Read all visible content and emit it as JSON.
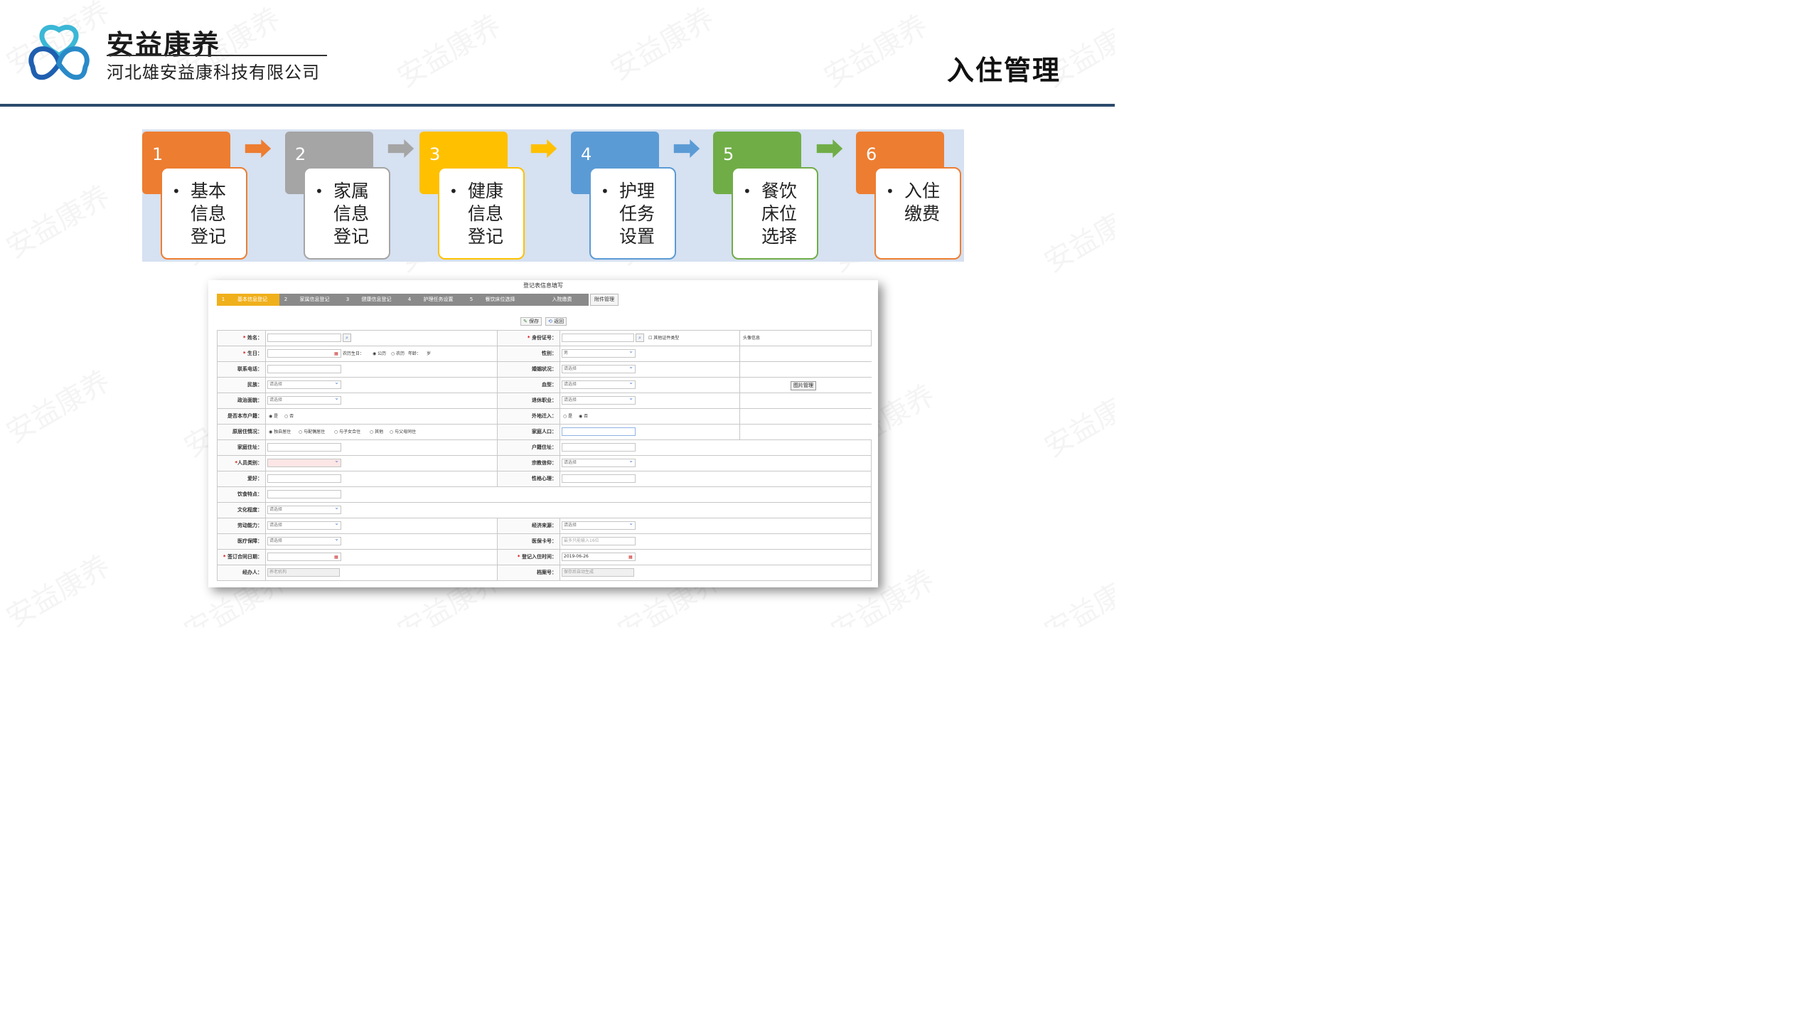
{
  "header": {
    "brand_name": "安益康养",
    "company": "河北雄安益康科技有限公司",
    "page_title": "入住管理",
    "logo_icon": "tri-loop-logo-icon",
    "watermark": "安益康养"
  },
  "process": {
    "steps": [
      {
        "num": "1",
        "lines": [
          "基本",
          "信息",
          "登记"
        ],
        "color": "#ed7d31"
      },
      {
        "num": "2",
        "lines": [
          "家属",
          "信息",
          "登记"
        ],
        "color": "#a5a5a5"
      },
      {
        "num": "3",
        "lines": [
          "健康",
          "信息",
          "登记"
        ],
        "color": "#ffc000"
      },
      {
        "num": "4",
        "lines": [
          "护理",
          "任务",
          "设置"
        ],
        "color": "#5b9bd5"
      },
      {
        "num": "5",
        "lines": [
          "餐饮",
          "床位",
          "选择"
        ],
        "color": "#70ad47"
      },
      {
        "num": "6",
        "lines": [
          "入住",
          "缴费"
        ],
        "color": "#ed7d31"
      }
    ],
    "arrow_colors": [
      "#ed7d31",
      "#a5a5a5",
      "#ffc000",
      "#5b9bd5",
      "#70ad47"
    ],
    "bullet": "•"
  },
  "form_screen": {
    "title": "登记表信息填写",
    "tabs": [
      {
        "num": "1",
        "label": "基本信息登记",
        "active": true
      },
      {
        "num": "2",
        "label": "家属信息登记"
      },
      {
        "num": "3",
        "label": "健康信息登记"
      },
      {
        "num": "4",
        "label": "护理任务设置"
      },
      {
        "num": "5",
        "label": "餐饮床位选择"
      },
      {
        "num": "",
        "label": "入院缴费"
      }
    ],
    "attach_tab": "附件管理",
    "save_label": "保存",
    "back_label": "返回",
    "photo_header": "头像信息",
    "photo_button": "图片管理",
    "labels": {
      "name": "姓名：",
      "idno": "身份证号：",
      "other_id": "其他证件类型",
      "birthday": "生日：",
      "lunar_birthday": "农历生日：",
      "calendar_solar": "公历",
      "calendar_lunar": "农历",
      "age": "年龄：",
      "age_unit": "岁",
      "gender": "性别：",
      "phone": "联系电话：",
      "marital": "婚姻状况：",
      "nation": "民族：",
      "blood": "血型：",
      "political": "政治面貌：",
      "retire_job": "退休职业：",
      "local_hukou": "是否本市户籍：",
      "yes": "是",
      "no": "否",
      "moved_in": "外地迁入：",
      "living": "原居住情况：",
      "living_opts": [
        "独自居住",
        "与配偶居住",
        "与子女合住",
        "其他",
        "与父母同住"
      ],
      "family_count": "家庭人口：",
      "home_addr": "家庭住址：",
      "hukou_addr": "户籍住址：",
      "person_type": "人员类别：",
      "religion": "宗教信仰：",
      "hobby": "爱好：",
      "personality": "性格心理：",
      "diet": "饮食特点：",
      "education": "文化程度：",
      "labor": "劳动能力：",
      "income": "经济来源：",
      "medical": "医疗保障：",
      "medical_card": "医保卡号：",
      "contract_date": "签订合同日期：",
      "checkin_time": "登记入住时间：",
      "operator": "经办人：",
      "file_no": "档案号："
    },
    "values": {
      "please_select": "请选择",
      "gender": "男",
      "medical_card_placeholder": "最多只能输入16位",
      "checkin_time": "2019-06-26",
      "operator": "养老机构",
      "file_no_placeholder": "保存后自动生成"
    }
  }
}
